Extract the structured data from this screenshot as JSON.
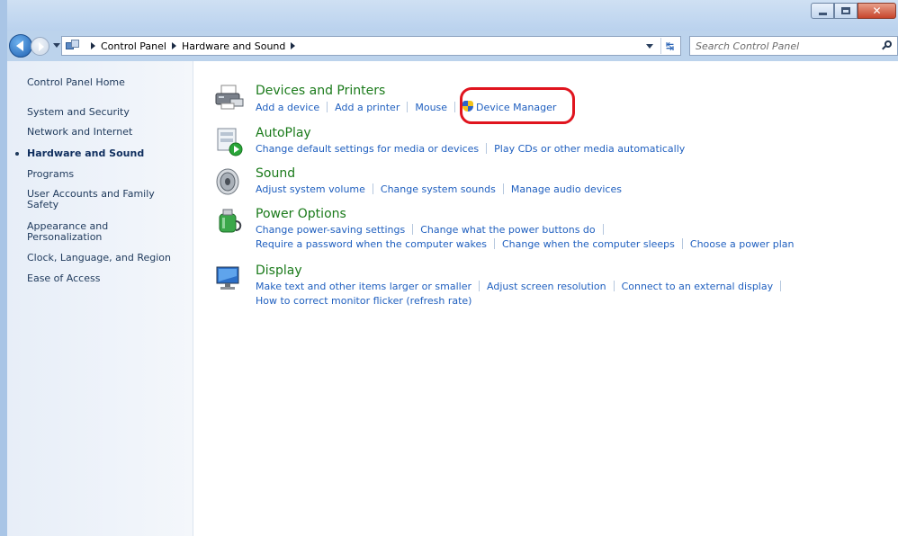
{
  "address_bar": {
    "breadcrumbs": [
      "Control Panel",
      "Hardware and Sound"
    ],
    "search_placeholder": "Search Control Panel"
  },
  "sidebar": {
    "items": [
      {
        "label": "Control Panel Home",
        "active": false
      },
      {
        "label": "System and Security",
        "active": false
      },
      {
        "label": "Network and Internet",
        "active": false
      },
      {
        "label": "Hardware and Sound",
        "active": true
      },
      {
        "label": "Programs",
        "active": false
      },
      {
        "label": "User Accounts and Family Safety",
        "active": false
      },
      {
        "label": "Appearance and Personalization",
        "active": false
      },
      {
        "label": "Clock, Language, and Region",
        "active": false
      },
      {
        "label": "Ease of Access",
        "active": false
      }
    ]
  },
  "categories": [
    {
      "title": "Devices and Printers",
      "icon": "printer-icon",
      "link_rows": [
        [
          "Add a device",
          "Add a printer",
          "Mouse",
          "Device Manager"
        ]
      ]
    },
    {
      "title": "AutoPlay",
      "icon": "autoplay-icon",
      "link_rows": [
        [
          "Change default settings for media or devices",
          "Play CDs or other media automatically"
        ]
      ]
    },
    {
      "title": "Sound",
      "icon": "speaker-icon",
      "link_rows": [
        [
          "Adjust system volume",
          "Change system sounds",
          "Manage audio devices"
        ]
      ]
    },
    {
      "title": "Power Options",
      "icon": "power-icon",
      "link_rows": [
        [
          "Change power-saving settings",
          "Change what the power buttons do"
        ],
        [
          "Require a password when the computer wakes",
          "Change when the computer sleeps",
          "Choose a power plan"
        ]
      ]
    },
    {
      "title": "Display",
      "icon": "monitor-icon",
      "link_rows": [
        [
          "Make text and other items larger or smaller",
          "Adjust screen resolution",
          "Connect to an external display"
        ],
        [
          "How to correct monitor flicker (refresh rate)"
        ]
      ]
    }
  ],
  "colors": {
    "link": "#1f5fbf",
    "category_title": "#1a7a1a",
    "highlight_circle": "#e0141e"
  }
}
